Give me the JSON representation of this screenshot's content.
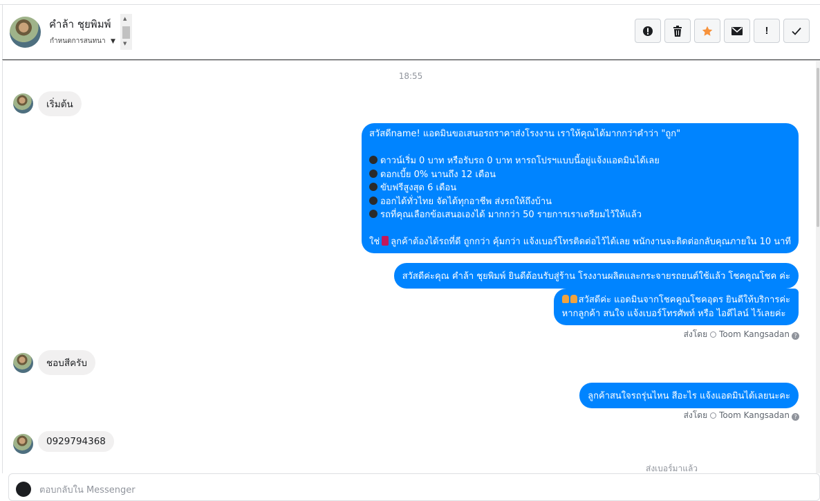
{
  "header": {
    "contact_name": "คำล้า ชุยพิมพ์",
    "contact_sub": "กำหนดการสนทนา",
    "actions": [
      {
        "icon": "alert-circle-icon",
        "glyph": "❗"
      },
      {
        "icon": "trash-icon",
        "glyph": "🗑"
      },
      {
        "icon": "star-icon",
        "glyph": "★"
      },
      {
        "icon": "envelope-icon",
        "glyph": "✉"
      },
      {
        "icon": "exclamation-icon",
        "glyph": "!"
      },
      {
        "icon": "checkmark-icon",
        "glyph": "✓"
      }
    ]
  },
  "conversation": {
    "timestamp": "18:55",
    "incoming_1": "เริ่มต้น",
    "outgoing_offer": {
      "lines": [
        "สวัสดีname! แอดมินขอเสนอรถราคาส่งโรงงาน เราให้คุณได้มากกว่าคำว่า \"ถูก\"",
        "",
        "ดาวน์เริ่ม 0 บาท หรือรับรถ 0 บาท หารถโปรฯแบบนี้อยู่แจ้งแอดมินได้เลย",
        "ดอกเบี้ย 0% นานถึง 12 เดือน",
        "ขับฟรีสูงสุด 6 เดือน",
        "ออกได้ทั่วไทย จัดได้ทุกอาชีพ ส่งรถให้ถึงบ้าน",
        "รถที่คุณเลือกข้อเสนอเองได้ มากกว่า 50 รายการเราเตรียมไว้ให้แล้ว",
        "",
        "ลูกค้าต้องได้รถที่ดี ถูกกว่า คุ้มกว่า แจ้งเบอร์โทรติดต่อไว้ได้เลย พนักงานจะติดต่อกลับคุณภายใน 10 นาที"
      ],
      "last_line_prefix": "ใช่",
      "bullet_icon": "car-emoji-icon"
    },
    "outgoing_welcome": "สวัสดีค่ะคุณ คำล้า ชุยพิมพ์ ยินดีต้อนรับสู่ร้าน โรงงานผลิตและกระจายรถยนต์ใช้แล้ว โชคคูณโชค ค่ะ",
    "outgoing_admin_1": "สวัสดีค่ะ แอดมินจากโชคคูณโชคอุดร ยินดีให้บริการค่ะ",
    "outgoing_admin_2": "หากลูกค้า สนใจ แจ้งเบอร์โทรศัพท์ หรือ ไอดีไลน์  ไว้เลยค่ะ",
    "sent_by_label": "ส่งโดย",
    "sent_by_name": "Toom Kangsadan",
    "incoming_2": "ชอบสีครับ",
    "outgoing_question": "ลูกค้าสนใจรถรุ่นไหน สีอะไร แจ้งแอดมินได้เลยนะคะ",
    "incoming_3": "0929794368",
    "cut_off_text": "ส่งเบอร์มาแล้ว"
  },
  "composer": {
    "placeholder": "ตอบกลับใน Messenger"
  }
}
